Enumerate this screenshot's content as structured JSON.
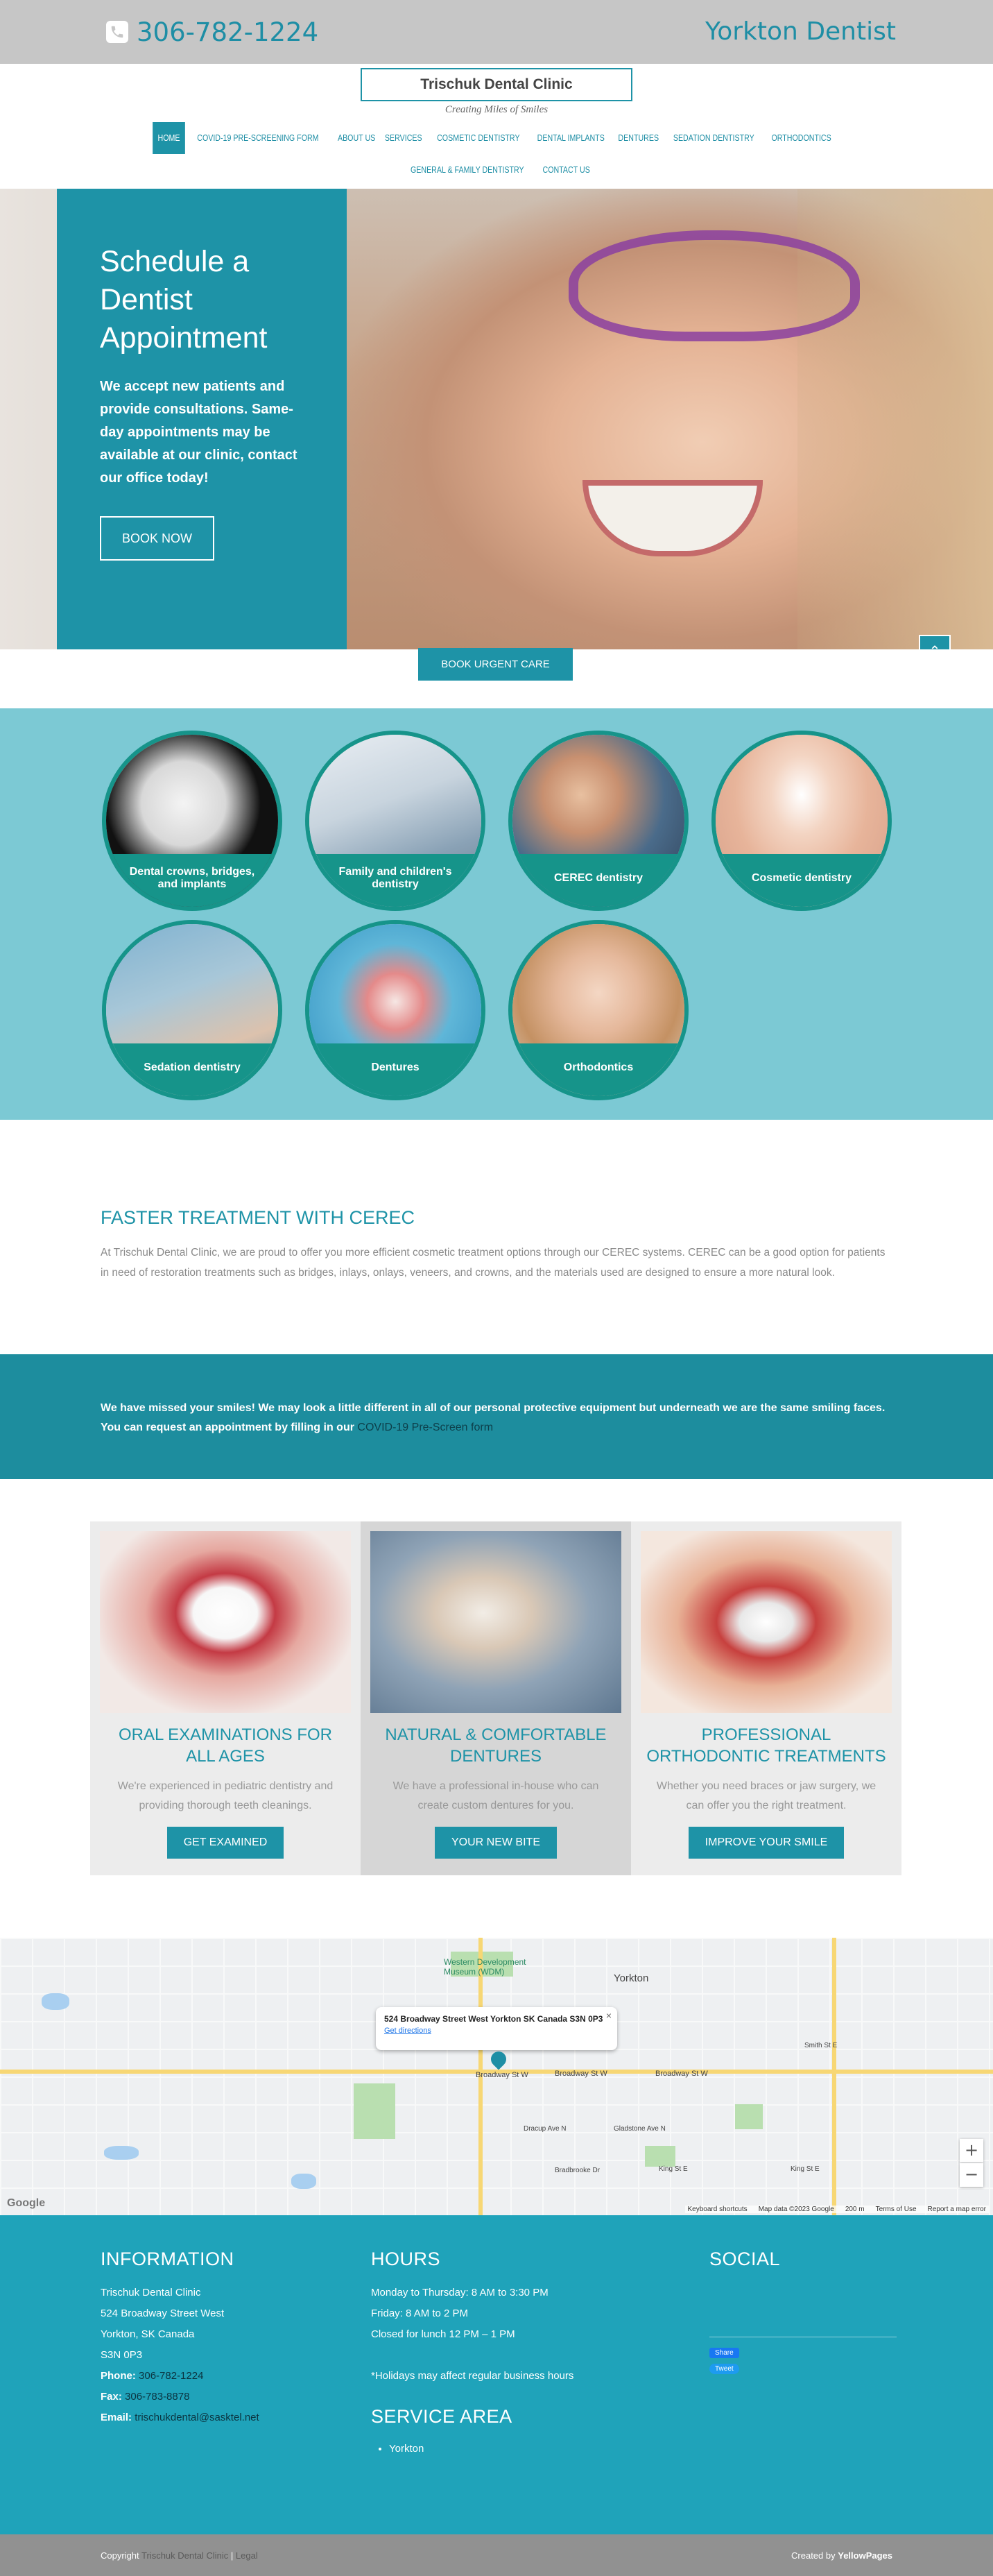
{
  "header": {
    "phone": "306-782-1224",
    "city_title": "Yorkton Dentist",
    "logo_text": "Trischuk Dental Clinic",
    "tagline": "Creating Miles of Smiles"
  },
  "nav": [
    "HOME",
    "COVID-19 PRE-SCREENING FORM",
    "ABOUT US",
    "SERVICES",
    "COSMETIC DENTISTRY",
    "DENTAL IMPLANTS",
    "DENTURES",
    "SEDATION DENTISTRY",
    "ORTHODONTICS",
    "GENERAL & FAMILY DENTISTRY",
    "CONTACT US"
  ],
  "hero": {
    "title": "Schedule a Dentist Appointment",
    "text": "We accept new patients and provide consultations. Same-day appointments may be available at our clinic, contact our office today!",
    "button": "BOOK NOW",
    "urgent_button": "BOOK URGENT CARE"
  },
  "services": [
    {
      "label": "Dental crowns, bridges, and implants"
    },
    {
      "label": "Family and children's dentistry"
    },
    {
      "label": "CEREC dentistry"
    },
    {
      "label": "Cosmetic dentistry"
    },
    {
      "label": "Sedation dentistry"
    },
    {
      "label": "Dentures"
    },
    {
      "label": "Orthodontics"
    }
  ],
  "cerec": {
    "title": "FASTER TREATMENT WITH CEREC",
    "text": "At Trischuk Dental Clinic, we are proud to offer you more efficient cosmetic treatment options through our CEREC systems. CEREC can be a good option for patients in need of restoration treatments such as bridges, inlays, onlays, veneers, and crowns, and the materials used are designed to ensure a more natural look."
  },
  "banner": {
    "text": "We have missed your smiles! We may look a little different in all of our personal protective equipment but underneath we are the same smiling faces. You can request an appointment by filling in our",
    "link": "COVID-19 Pre-Screen form"
  },
  "cards": [
    {
      "title": "ORAL EXAMINATIONS FOR ALL AGES",
      "text": "We're experienced in pediatric dentistry and providing thorough teeth cleanings.",
      "button": "GET EXAMINED"
    },
    {
      "title": "NATURAL & COMFORTABLE DENTURES",
      "text": "We have a professional in-house who can create custom dentures for you.",
      "button": "YOUR NEW BITE"
    },
    {
      "title": "PROFESSIONAL ORTHODONTIC TREATMENTS",
      "text": "Whether you need braces or jaw surgery, we can offer you the right treatment.",
      "button": "IMPROVE YOUR SMILE"
    }
  ],
  "map": {
    "address": "524 Broadway Street West Yorkton SK Canada S3N 0P3",
    "directions": "Get directions",
    "town": "Yorkton",
    "poi": "Western Development Museum (WDM)",
    "streets": [
      "Broadway St W",
      "Broadway St W",
      "Broadway St W",
      "Smith St E",
      "King St E",
      "King St E",
      "Bradbrooke Dr",
      "Gladstone Ave N",
      "Dracup Ave N"
    ],
    "attribution": [
      "Keyboard shortcuts",
      "Map data ©2023 Google",
      "200 m",
      "Terms of Use",
      "Report a map error"
    ],
    "google": "Google",
    "zoom_in": "+",
    "zoom_out": "−"
  },
  "footer": {
    "info_title": "INFORMATION",
    "info_lines": [
      "Trischuk Dental Clinic",
      "524 Broadway Street West",
      "Yorkton, SK Canada",
      "S3N 0P3"
    ],
    "phone_label": "Phone:",
    "phone": "306-782-1224",
    "fax_label": "Fax:",
    "fax": "306-783-8878",
    "email_label": "Email:",
    "email": "trischukdental@sasktel.net",
    "hours_title": "HOURS",
    "hours_lines": [
      "Monday to Thursday: 8 AM to 3:30 PM",
      "Friday: 8 AM to 2 PM",
      "Closed for lunch 12 PM – 1 PM"
    ],
    "holiday_note": "*Holidays may affect regular business hours",
    "area_title": "SERVICE AREA",
    "area_items": [
      "Yorkton"
    ],
    "social_title": "SOCIAL",
    "share": "Share",
    "tweet": "Tweet"
  },
  "bottom": {
    "copyright": "Copyright",
    "owner": "Trischuk Dental Clinic",
    "sep": "|",
    "legal": "Legal",
    "created_by": "Created by",
    "brand": "YellowPages"
  },
  "colors": {
    "accent": "#1e93a7",
    "teal_dark": "#16948a",
    "services_bg": "#7cc9d4",
    "footer_bg": "#1fa3ba"
  },
  "icons": [
    "phone-icon",
    "chevron-up-icon",
    "map-pin-icon",
    "close-icon"
  ]
}
